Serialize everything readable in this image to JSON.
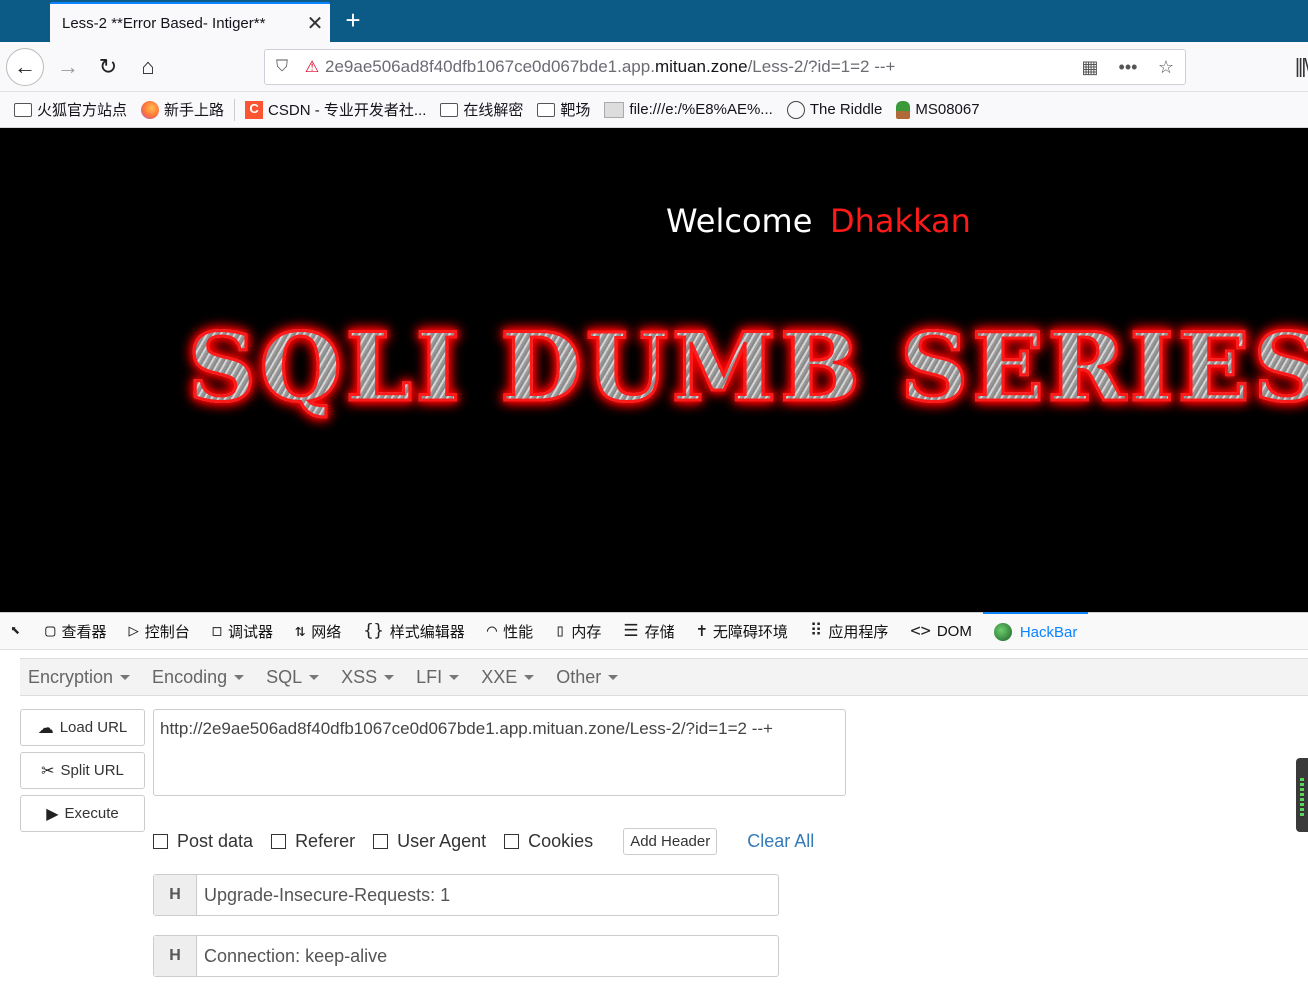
{
  "browser": {
    "tab_title": "Less-2 **Error Based- Intiger**",
    "tab_close": "✕",
    "new_tab": "+",
    "url_prefix": "2e9ae506ad8f40dfb1067ce0d067bde1.app.",
    "url_domain": "mituan.zone",
    "url_suffix": "/Less-2/?id=1=2 --+"
  },
  "bookmarks": [
    {
      "label": "火狐官方站点",
      "icon": "folder-icon"
    },
    {
      "label": "新手上路",
      "icon": "firefox-icon"
    },
    {
      "label": "CSDN - 专业开发者社...",
      "icon": "csdn-icon"
    },
    {
      "label": "在线解密",
      "icon": "folder-icon"
    },
    {
      "label": "靶场",
      "icon": "folder-icon"
    },
    {
      "label": "file:///e:/%E8%AE%...",
      "icon": "file-icon"
    },
    {
      "label": "The Riddle",
      "icon": "globe-icon"
    },
    {
      "label": "MS08067",
      "icon": "plant-icon"
    }
  ],
  "page": {
    "welcome": "Welcome",
    "name": "Dhakkan",
    "banner": "SQLI DUMB SERIES"
  },
  "devtools": {
    "tabs": [
      "查看器",
      "控制台",
      "调试器",
      "网络",
      "样式编辑器",
      "性能",
      "内存",
      "存储",
      "无障碍环境",
      "应用程序",
      "DOM",
      "HackBar"
    ],
    "active_tab": "HackBar"
  },
  "hackbar": {
    "menu": [
      "Encryption",
      "Encoding",
      "SQL",
      "XSS",
      "LFI",
      "XXE",
      "Other"
    ],
    "load_url": "Load URL",
    "split_url": "Split URL",
    "execute": "Execute",
    "url_value": "http://2e9ae506ad8f40dfb1067ce0d067bde1.app.mituan.zone/Less-2/?id=1=2 --+",
    "options": [
      "Post data",
      "Referer",
      "User Agent",
      "Cookies"
    ],
    "add_header": "Add Header",
    "clear_all": "Clear All",
    "headers": [
      {
        "label": "H",
        "value": "Upgrade-Insecure-Requests: 1"
      },
      {
        "label": "H",
        "value": "Connection: keep-alive"
      }
    ]
  }
}
